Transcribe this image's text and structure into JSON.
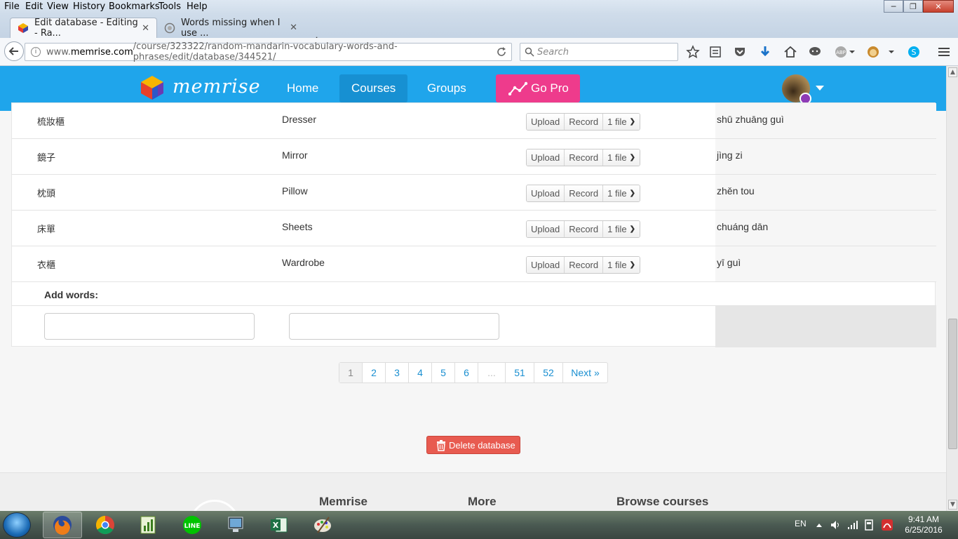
{
  "browser": {
    "menu": [
      "File",
      "Edit",
      "View",
      "History",
      "Bookmarks",
      "Tools",
      "Help"
    ],
    "tabs": [
      {
        "title": "Edit database - Editing - Ra...",
        "active": true
      },
      {
        "title": "Words missing when I use ...",
        "active": false
      }
    ],
    "url_prefix": "www.",
    "url_domain": "memrise.com",
    "url_path": "/course/323322/random-mandarin-vocabulary-words-and-phrases/edit/database/344521/",
    "search_placeholder": "Search"
  },
  "site": {
    "brand": "memrise",
    "nav": [
      "Home",
      "Courses",
      "Groups"
    ],
    "active_nav": "Courses",
    "gopro_label": "Go Pro",
    "accent_color": "#1fa5eb",
    "gopro_color": "#ee3b8c"
  },
  "database": {
    "rows": [
      {
        "chinese": "梳妝櫃",
        "english": "Dresser",
        "upload": "Upload",
        "record": "Record",
        "files": "1 file",
        "pinyin": "shū zhuāng guì"
      },
      {
        "chinese": "鏡子",
        "english": "Mirror",
        "upload": "Upload",
        "record": "Record",
        "files": "1 file",
        "pinyin": "jìng zi"
      },
      {
        "chinese": "枕頭",
        "english": "Pillow",
        "upload": "Upload",
        "record": "Record",
        "files": "1 file",
        "pinyin": "zhěn tou"
      },
      {
        "chinese": "床單",
        "english": "Sheets",
        "upload": "Upload",
        "record": "Record",
        "files": "1 file",
        "pinyin": "chuáng dān"
      },
      {
        "chinese": "衣櫃",
        "english": "Wardrobe",
        "upload": "Upload",
        "record": "Record",
        "files": "1 file",
        "pinyin": "yī guì"
      }
    ],
    "add_words_label": "Add words:"
  },
  "pagination": {
    "pages": [
      "1",
      "2",
      "3",
      "4",
      "5",
      "6",
      "...",
      "51",
      "52",
      "Next »"
    ],
    "current": "1"
  },
  "delete_label": "Delete database",
  "footer": {
    "headings": [
      "Memrise",
      "More",
      "Browse courses"
    ]
  },
  "taskbar": {
    "language": "EN",
    "time": "9:41 AM",
    "date": "6/25/2016"
  }
}
